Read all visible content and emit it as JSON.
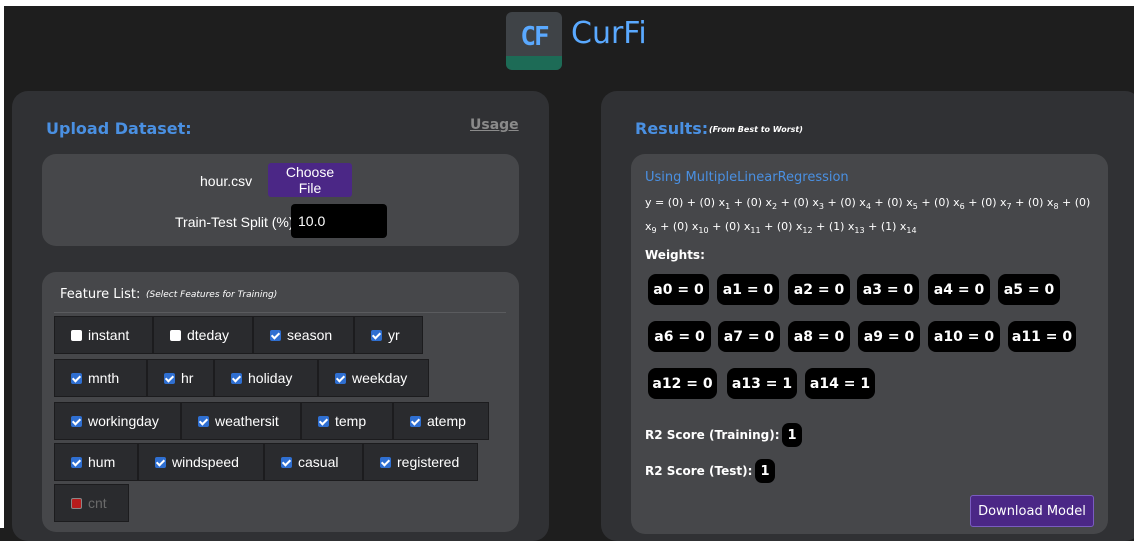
{
  "app": {
    "title": "CurFi",
    "logo_text": "CF"
  },
  "colors": {
    "accent": "#4a90e2",
    "button": "#4b2786",
    "checkbox": "#2f6fd1"
  },
  "upload": {
    "title": "Upload Dataset:",
    "usage_link": "Usage",
    "file_name": "hour.csv",
    "choose_label": "Choose File",
    "split_label": "Train-Test Split (%):",
    "split_value": "10.0"
  },
  "features": {
    "label": "Feature List:",
    "hint": "(Select Features for Training)",
    "items": [
      {
        "name": "instant",
        "checked": false
      },
      {
        "name": "dteday",
        "checked": false
      },
      {
        "name": "season",
        "checked": true
      },
      {
        "name": "yr",
        "checked": true
      },
      {
        "name": "mnth",
        "checked": true
      },
      {
        "name": "hr",
        "checked": true
      },
      {
        "name": "holiday",
        "checked": true
      },
      {
        "name": "weekday",
        "checked": true
      },
      {
        "name": "workingday",
        "checked": true
      },
      {
        "name": "weathersit",
        "checked": true
      },
      {
        "name": "temp",
        "checked": true
      },
      {
        "name": "atemp",
        "checked": true
      },
      {
        "name": "hum",
        "checked": true
      },
      {
        "name": "windspeed",
        "checked": true
      },
      {
        "name": "casual",
        "checked": true
      },
      {
        "name": "registered",
        "checked": true
      },
      {
        "name": "cnt",
        "checked": false,
        "disabled": true
      }
    ]
  },
  "results": {
    "title": "Results:",
    "subtitle": "(From Best to Worst)",
    "algorithm": "Using MultipleLinearRegression",
    "equation": "y = (0) + (0) x1 + (0) x2 + (0) x3 + (0) x4 + (0) x5 + (0) x6 + (0) x7 + (0) x8 + (0) x9 + (0) x10 + (0) x11 + (0) x12 + (1) x13 + (1) x14",
    "weights_label": "Weights:",
    "weights": [
      "a0 = 0",
      "a1 = 0",
      "a2 = 0",
      "a3 = 0",
      "a4 = 0",
      "a5 = 0",
      "a6 = 0",
      "a7 = 0",
      "a8 = 0",
      "a9 = 0",
      "a10 = 0",
      "a11 = 0",
      "a12 = 0",
      "a13 = 1",
      "a14 = 1"
    ],
    "r2_training_label": "R2 Score (Training):",
    "r2_training": "1",
    "r2_test_label": "R2 Score (Test):",
    "r2_test": "1",
    "download_label": "Download Model"
  }
}
